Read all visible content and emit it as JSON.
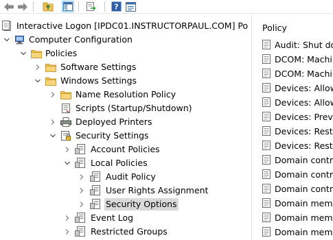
{
  "toolbar": {
    "buttons": [
      {
        "icon": "back-arrow-icon"
      },
      {
        "icon": "forward-arrow-icon"
      },
      {
        "icon": "up-folder-icon"
      },
      {
        "icon": "show-hide-tree-icon"
      },
      {
        "icon": "export-list-icon"
      },
      {
        "icon": "help-icon"
      },
      {
        "icon": "properties-icon"
      }
    ]
  },
  "tree": {
    "root_label": "Interactive Logon [IPDC01.INSTRUCTORPAUL.COM] Po",
    "items": [
      {
        "label": "Computer Configuration",
        "icon": "computer-icon"
      },
      {
        "label": "Policies",
        "icon": "folder-icon"
      },
      {
        "label": "Software Settings",
        "icon": "folder-icon"
      },
      {
        "label": "Windows Settings",
        "icon": "folder-icon"
      },
      {
        "label": "Name Resolution Policy",
        "icon": "folder-icon"
      },
      {
        "label": "Scripts (Startup/Shutdown)",
        "icon": "scripts-icon"
      },
      {
        "label": "Deployed Printers",
        "icon": "printer-icon"
      },
      {
        "label": "Security Settings",
        "icon": "security-settings-icon"
      },
      {
        "label": "Account Policies",
        "icon": "policy-icon"
      },
      {
        "label": "Local Policies",
        "icon": "policy-icon"
      },
      {
        "label": "Audit Policy",
        "icon": "policy-icon"
      },
      {
        "label": "User Rights Assignment",
        "icon": "policy-icon"
      },
      {
        "label": "Security Options",
        "icon": "policy-icon"
      },
      {
        "label": "Event Log",
        "icon": "policy-icon"
      },
      {
        "label": "Restricted Groups",
        "icon": "policy-icon"
      }
    ]
  },
  "list": {
    "column_header": "Policy",
    "items": [
      "Audit: Shut do",
      "DCOM: Machi",
      "DCOM: Machi",
      "Devices: Allow",
      "Devices: Allow",
      "Devices: Preve",
      "Devices: Restri",
      "Devices: Restri",
      "Domain contro",
      "Domain contro",
      "Domain contro",
      "Domain memb",
      "Domain memb",
      "Domain memb"
    ]
  },
  "colors": {
    "selection": "#d9d9d9",
    "folder": "#f2c25a",
    "toolbar_pressed": "#cce8ff"
  }
}
